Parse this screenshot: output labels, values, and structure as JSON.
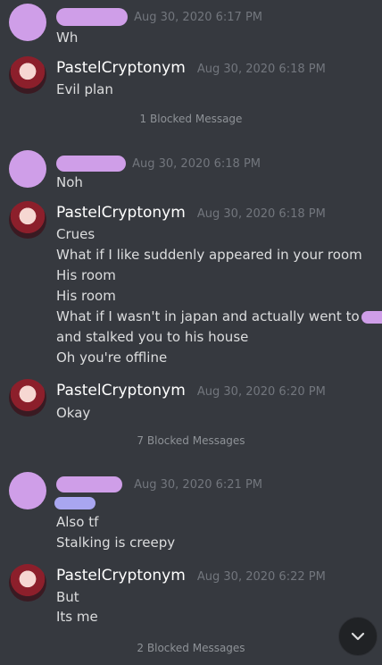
{
  "colors": {
    "background": "#36393f",
    "username": "#ffffff",
    "timestamp": "#72767d",
    "redaction": "#cf9ee8"
  },
  "messages": [
    {
      "ts": "Aug 30, 2020 6:17 PM",
      "lines": [
        "Wh"
      ]
    },
    {
      "user": "PastelCryptonym",
      "ts": "Aug 30, 2020 6:18 PM",
      "lines": [
        "Evil plan"
      ]
    },
    {
      "blocked": "1 Blocked Message"
    },
    {
      "ts": "Aug 30, 2020 6:18 PM",
      "lines": [
        "Noh"
      ]
    },
    {
      "user": "PastelCryptonym",
      "ts": "Aug 30, 2020 6:18 PM",
      "lines": [
        "Crues",
        "What if I like suddenly appeared in your room",
        "His room",
        "His room",
        "What if I wasn't in japan and actually went to",
        "and stalked you to his house",
        "Oh you're offline"
      ]
    },
    {
      "user": "PastelCryptonym",
      "ts": "Aug 30, 2020 6:20 PM",
      "lines": [
        "Okay"
      ]
    },
    {
      "blocked": "7 Blocked Messages"
    },
    {
      "ts": "Aug 30, 2020 6:21 PM",
      "lines": [
        "Also tf",
        "Stalking is creepy"
      ]
    },
    {
      "user": "PastelCryptonym",
      "ts": "Aug 30, 2020 6:22 PM",
      "lines": [
        "But",
        "Its me"
      ]
    },
    {
      "blocked": "2 Blocked Messages"
    }
  ],
  "scroll_button": {
    "icon": "chevron-down-icon"
  }
}
